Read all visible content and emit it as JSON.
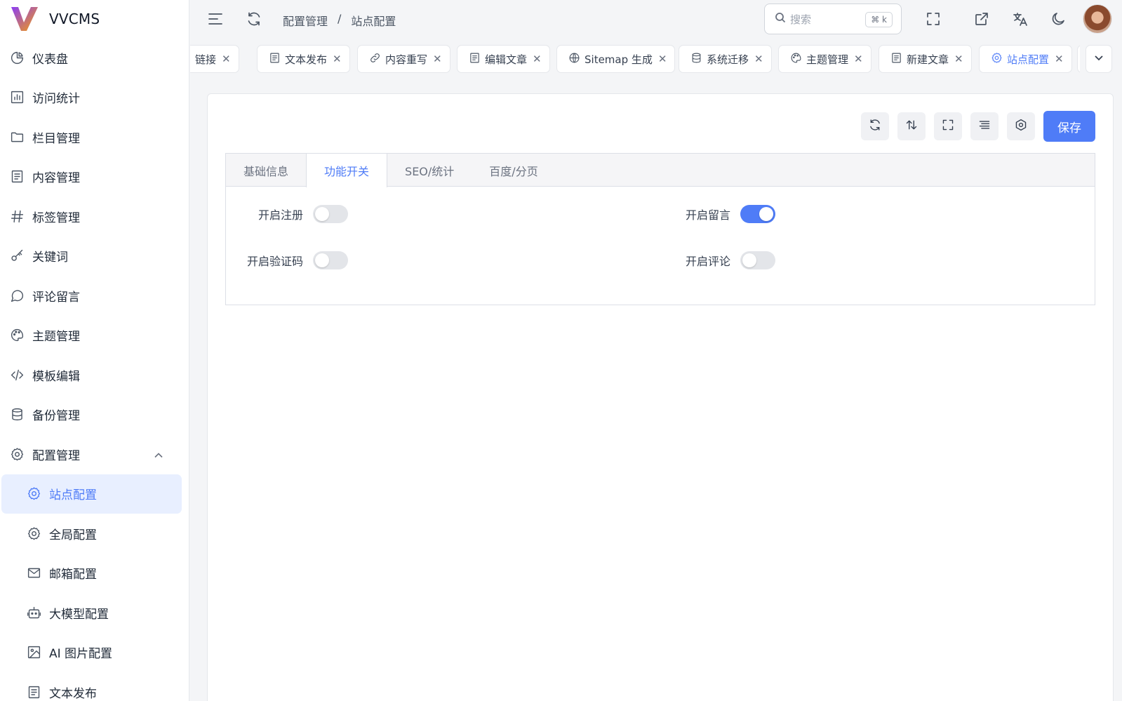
{
  "app": {
    "name": "VVCMS"
  },
  "sidebar": {
    "items": [
      {
        "label": "仪表盘"
      },
      {
        "label": "访问统计"
      },
      {
        "label": "栏目管理"
      },
      {
        "label": "内容管理"
      },
      {
        "label": "标签管理"
      },
      {
        "label": "关键词"
      },
      {
        "label": "评论留言"
      },
      {
        "label": "主题管理"
      },
      {
        "label": "模板编辑"
      },
      {
        "label": "备份管理"
      },
      {
        "label": "配置管理"
      }
    ],
    "sub_items": [
      {
        "label": "站点配置"
      },
      {
        "label": "全局配置"
      },
      {
        "label": "邮箱配置"
      },
      {
        "label": "大模型配置"
      },
      {
        "label": "AI 图片配置"
      },
      {
        "label": "文本发布"
      }
    ]
  },
  "header": {
    "breadcrumb": [
      "配置管理",
      "/",
      "站点配置"
    ],
    "search": {
      "placeholder": "搜索",
      "shortcut": "⌘ k"
    }
  },
  "page_tabs": [
    {
      "label": "链接"
    },
    {
      "label": "文本发布"
    },
    {
      "label": "内容重写"
    },
    {
      "label": "编辑文章"
    },
    {
      "label": "Sitemap 生成"
    },
    {
      "label": "系统迁移"
    },
    {
      "label": "主题管理"
    },
    {
      "label": "新建文章"
    },
    {
      "label": "站点配置"
    }
  ],
  "toolbar": {
    "save_label": "保存"
  },
  "form_tabs": [
    "基础信息",
    "功能开关",
    "SEO/统计",
    "百度/分页"
  ],
  "switches": [
    {
      "label": "开启注册",
      "on": false
    },
    {
      "label": "开启留言",
      "on": true
    },
    {
      "label": "开启验证码",
      "on": false
    },
    {
      "label": "开启评论",
      "on": false
    }
  ],
  "colors": {
    "accent": "#4f7cf7",
    "switch_off": "#e3e5e9"
  }
}
